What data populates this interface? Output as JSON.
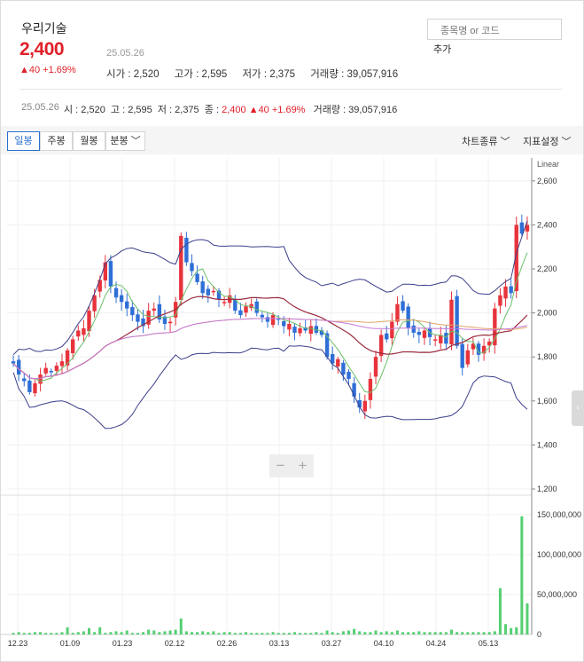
{
  "stock": {
    "name": "우리기술",
    "price": "2,400",
    "change": "40 +1.69%",
    "date": "25.05.26",
    "open": "시가 : 2,520",
    "high": "고가 : 2,595",
    "low": "저가 : 2,375",
    "volume": "거래량 : 39,057,916"
  },
  "search": {
    "placeholder": "종목명 or 코드",
    "add_label": "추가"
  },
  "summary": {
    "date": "25.05.26",
    "text": "시 : 2,520  고 : 2,595  저 : 2,375  종 : ",
    "close": "2,400",
    "change": "40 +1.69%",
    "volume": "거래량 : 39,057,916"
  },
  "toolbar": {
    "tabs": [
      "일봉",
      "주봉",
      "월봉",
      "분봉"
    ],
    "chart_type": "차트종류",
    "indicator": "지표설정"
  },
  "chart_data": {
    "type": "candlestick",
    "scale_label": "Linear",
    "price_ticks": [
      "2,600",
      "2,400",
      "2,200",
      "2,000",
      "1,800",
      "1,600",
      "1,400",
      "1,200"
    ],
    "price_tick_values": [
      2600,
      2400,
      2200,
      2000,
      1800,
      1600,
      1400,
      1200
    ],
    "price_range": [
      1200,
      2680
    ],
    "volume_ticks": [
      "150,000,000",
      "100,000,000",
      "50,000,000",
      "0"
    ],
    "volume_tick_values": [
      150000000,
      100000000,
      50000000,
      0
    ],
    "volume_range": [
      0,
      170000000
    ],
    "x_labels": [
      "12.23",
      "01.09",
      "01.23",
      "02.12",
      "02.26",
      "03.13",
      "03.27",
      "04.10",
      "04.24",
      "05.13"
    ],
    "closes": [
      1770,
      1720,
      1690,
      1640,
      1680,
      1720,
      1750,
      1730,
      1760,
      1780,
      1830,
      1880,
      1920,
      1930,
      2010,
      2080,
      2150,
      2230,
      2120,
      2070,
      2050,
      2020,
      1990,
      1960,
      1940,
      2010,
      2020,
      1970,
      1950,
      1960,
      2050,
      2350,
      2230,
      2190,
      2140,
      2090,
      2080,
      2100,
      2060,
      2050,
      2080,
      2010,
      1990,
      2030,
      2040,
      2000,
      1980,
      1960,
      1990,
      1970,
      1940,
      1950,
      1910,
      1930,
      1920,
      1940,
      1910,
      1900,
      1800,
      1770,
      1790,
      1720,
      1700,
      1620,
      1570,
      1600,
      1700,
      1800,
      1900,
      1880,
      1960,
      2040,
      2010,
      1930,
      1910,
      1900,
      1920,
      1890,
      1880,
      1900,
      1860,
      2060,
      1850,
      1750,
      1830,
      1860,
      1810,
      1850,
      1870,
      2020,
      2080,
      2120,
      2090,
      2400,
      2360,
      2400
    ],
    "volumes": [
      2,
      3,
      2,
      2,
      3,
      3,
      2,
      2,
      2,
      3,
      9,
      2,
      3,
      4,
      8,
      3,
      9,
      2,
      3,
      4,
      3,
      5,
      2,
      2,
      3,
      6,
      5,
      3,
      4,
      5,
      6,
      20,
      4,
      3,
      3,
      4,
      3,
      4,
      2,
      3,
      3,
      2,
      2,
      3,
      2,
      2,
      2,
      2,
      3,
      2,
      2,
      2,
      3,
      2,
      2,
      2,
      3,
      2,
      5,
      3,
      2,
      4,
      5,
      7,
      4,
      3,
      3,
      5,
      3,
      4,
      3,
      5,
      3,
      3,
      3,
      4,
      3,
      3,
      3,
      3,
      3,
      6,
      3,
      3,
      3,
      3,
      3,
      3,
      3,
      4,
      58,
      13,
      8,
      9,
      148,
      39
    ]
  }
}
